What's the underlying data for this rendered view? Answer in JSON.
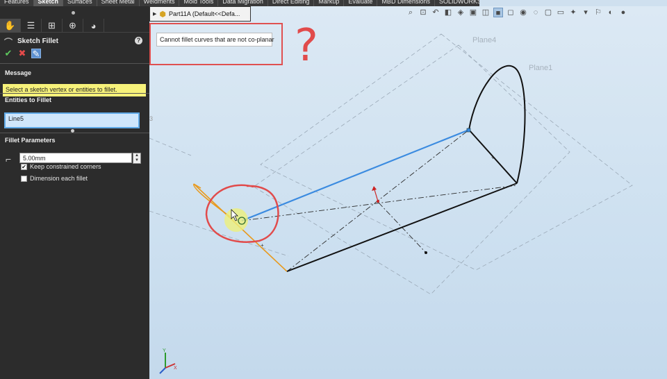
{
  "tabs": [
    {
      "label": "Features",
      "active": false
    },
    {
      "label": "Sketch",
      "active": true
    },
    {
      "label": "Surfaces",
      "active": false
    },
    {
      "label": "Sheet Metal",
      "active": false
    },
    {
      "label": "Weldments",
      "active": false
    },
    {
      "label": "Mold Tools",
      "active": false
    },
    {
      "label": "Data Migration",
      "active": false
    },
    {
      "label": "Direct Editing",
      "active": false
    },
    {
      "label": "Markup",
      "active": false
    },
    {
      "label": "Evaluate",
      "active": false
    },
    {
      "label": "MBD Dimensions",
      "active": false
    },
    {
      "label": "SOLIDWORKS Add-Ins",
      "active": false
    }
  ],
  "panel": {
    "title": "Sketch Fillet",
    "help": "?",
    "message_header": "Message",
    "message_text": "Select a sketch vertex or entities to fillet.",
    "entities_header": "Entities to Fillet",
    "entities_value": "Line5",
    "params_header": "Fillet Parameters",
    "radius_value": "5.00mm",
    "keep_constrained_label": "Keep constrained corners",
    "keep_constrained_checked": true,
    "dimension_each_label": "Dimension each fillet",
    "dimension_each_checked": false
  },
  "tree": {
    "label": "Part11A  (Default<<Defa..."
  },
  "tooltip": {
    "text": "Cannot fillet curves that are not co-planar"
  },
  "annotation": {
    "question_mark": "?"
  },
  "viewport": {
    "plane_labels": [
      "Plane4",
      "Plane1"
    ],
    "triad_labels": {
      "y": "Y",
      "x": "X"
    }
  },
  "colors": {
    "selected_line": "#3b8be0",
    "highlighted_line": "#e89a1e",
    "annotation": "#e05050",
    "message_bg": "#f7f27a"
  }
}
